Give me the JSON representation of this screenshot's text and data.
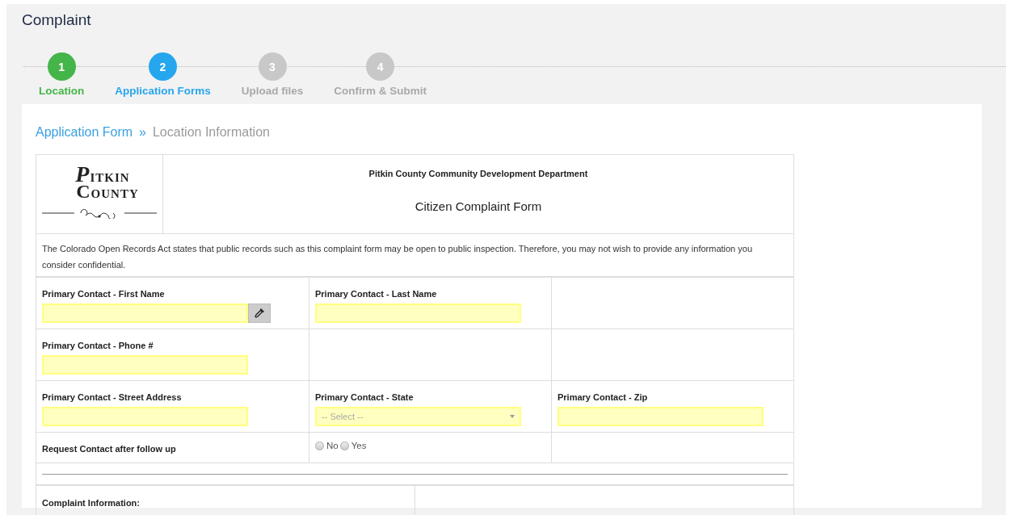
{
  "page_title": "Complaint",
  "steps": [
    {
      "number": "1",
      "label": "Location",
      "completed": true,
      "selected": false
    },
    {
      "number": "2",
      "label": "Application Forms",
      "completed": false,
      "selected": true
    },
    {
      "number": "3",
      "label": "Upload files",
      "completed": false,
      "selected": false
    },
    {
      "number": "4",
      "label": "Confirm & Submit",
      "completed": false,
      "selected": false
    }
  ],
  "breadcrumb": {
    "parent": "Application Form",
    "separator": "»",
    "current": "Location Information"
  },
  "form": {
    "logo": {
      "line_1": "PITKIN",
      "line_2": "COUNTY"
    },
    "organization": "Pitkin County Community Development  Department",
    "title": "Citizen Complaint Form",
    "notice": "The Colorado Open Records Act states that public records such as this complaint form may be open to public inspection. Therefore, you may not wish to provide any information you consider confidential.",
    "rows": [
      {
        "cells": [
          {
            "kind": "text",
            "label": "Primary Contact - First Name",
            "highlighted": true,
            "picker": true
          },
          {
            "kind": "text",
            "label": "Primary Contact - Last Name",
            "highlighted": true
          },
          {
            "kind": "empty"
          }
        ]
      },
      {
        "cells": [
          {
            "kind": "text",
            "label": "Primary Contact - Phone #",
            "highlighted": true
          },
          {
            "kind": "empty"
          },
          {
            "kind": "empty"
          }
        ]
      },
      {
        "cells": [
          {
            "kind": "text",
            "label": "Primary Contact - Street Address",
            "highlighted": true
          },
          {
            "kind": "select",
            "label": "Primary Contact - State",
            "placeholder": "-- Select --",
            "highlighted": true
          },
          {
            "kind": "text",
            "label": "Primary Contact - Zip",
            "highlighted": true
          }
        ]
      },
      {
        "cells": [
          {
            "kind": "label",
            "label": "Request Contact after follow up"
          },
          {
            "kind": "radio",
            "options": [
              {
                "label": "No",
                "selected": false
              },
              {
                "label": "Yes",
                "selected": false
              }
            ]
          },
          {
            "kind": "empty"
          }
        ]
      }
    ],
    "section_title": "Complaint Information:"
  }
}
